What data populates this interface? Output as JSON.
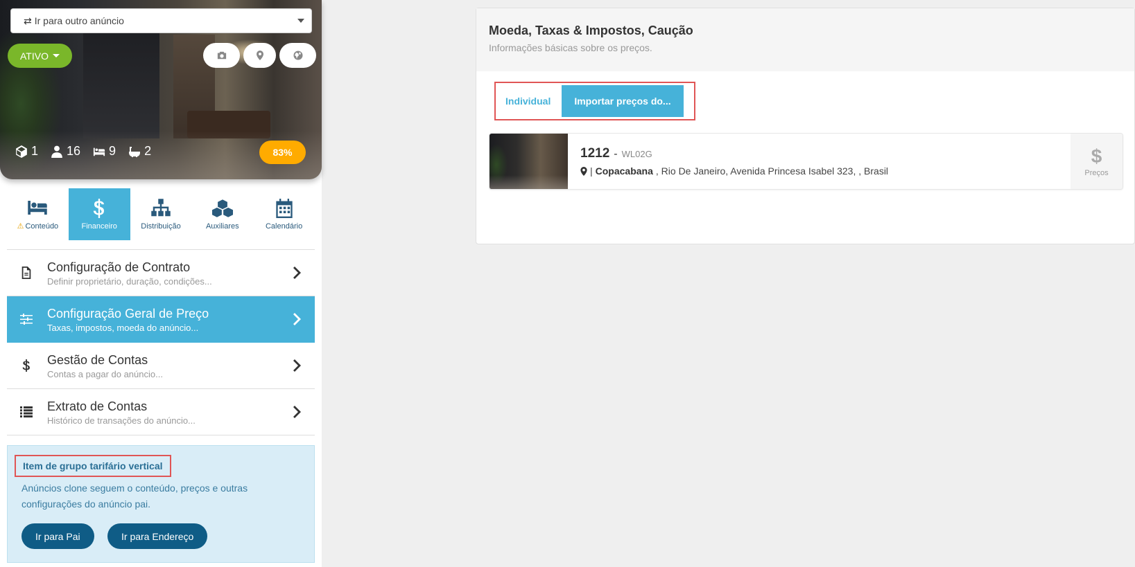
{
  "sidebar": {
    "goto_select": "Ir para outro anúncio",
    "status": "ATIVO",
    "stats": {
      "rooms": "1",
      "guests": "16",
      "beds": "9",
      "baths": "2"
    },
    "progress": "83%",
    "tabs": [
      {
        "label": "Conteúdo"
      },
      {
        "label": "Financeiro"
      },
      {
        "label": "Distribuição"
      },
      {
        "label": "Auxiliares"
      },
      {
        "label": "Calendário"
      }
    ],
    "menu": [
      {
        "title": "Configuração de Contrato",
        "sub": "Definir proprietário, duração, condições..."
      },
      {
        "title": "Configuração Geral de Preço",
        "sub": "Taxas, impostos, moeda do anúncio..."
      },
      {
        "title": "Gestão de Contas",
        "sub": "Contas a pagar do anúncio..."
      },
      {
        "title": "Extrato de Contas",
        "sub": "Histórico de transações do anúncio..."
      }
    ],
    "info": {
      "title": "Item de grupo tarifário vertical",
      "text": "Anúncios clone seguem o conteúdo, preços e outras configurações do anúncio pai.",
      "btn_parent": "Ir para Pai",
      "btn_address": "Ir para Endereço"
    }
  },
  "panel": {
    "title": "Moeda, Taxas & Impostos, Caução",
    "subtitle": "Informações básicas sobre os preços.",
    "toggle_individual": "Individual",
    "toggle_import": "Importar preços do...",
    "listing": {
      "number": "1212",
      "dash": "-",
      "code": "WL02G",
      "addr_sep": "|",
      "neighborhood": "Copacabana",
      "address": ", Rio De Janeiro, Avenida Princesa Isabel 323, , Brasil",
      "price_symbol": "$",
      "price_label": "Preços"
    }
  },
  "colors": {
    "accent": "#46b2d9",
    "active_green": "#7ab72a",
    "progress_orange": "#ffab00",
    "dark_button": "#0f5c86",
    "highlight_red": "#e05555"
  }
}
